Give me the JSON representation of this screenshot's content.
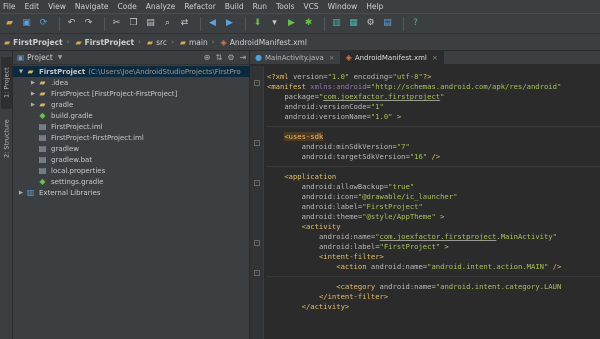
{
  "menu": [
    "File",
    "Edit",
    "View",
    "Navigate",
    "Code",
    "Analyze",
    "Refactor",
    "Build",
    "Run",
    "Tools",
    "VCS",
    "Window",
    "Help"
  ],
  "breadcrumbs": [
    {
      "label": "FirstProject",
      "icon": "folder-icon"
    },
    {
      "label": "FirstProject",
      "icon": "module-folder-icon"
    },
    {
      "label": "src",
      "icon": "folder-icon"
    },
    {
      "label": "main",
      "icon": "folder-icon"
    },
    {
      "label": "AndroidManifest.xml",
      "icon": "xml-file-icon"
    }
  ],
  "side_tabs": {
    "project": "1: Project",
    "structure": "2: Structure"
  },
  "project_panel": {
    "view_selector": "Project",
    "tree": [
      {
        "label": "FirstProject",
        "suffix": "(C:\\Users\\Joe\\AndroidStudioProjects\\FirstPro",
        "indent": 0,
        "icon": "folder",
        "expanded": true,
        "selected": true
      },
      {
        "label": ".idea",
        "indent": 1,
        "icon": "folder",
        "expanded": false
      },
      {
        "label": "FirstProject [FirstProject-FirstProject]",
        "indent": 1,
        "icon": "folder",
        "expanded": false
      },
      {
        "label": "gradle",
        "indent": 1,
        "icon": "folder",
        "expanded": false
      },
      {
        "label": "build.gradle",
        "indent": 1,
        "icon": "grad",
        "leaf": true
      },
      {
        "label": "FirstProject.iml",
        "indent": 1,
        "icon": "file",
        "leaf": true
      },
      {
        "label": "FirstProject-FirstProject.iml",
        "indent": 1,
        "icon": "file",
        "leaf": true
      },
      {
        "label": "gradlew",
        "indent": 1,
        "icon": "file",
        "leaf": true
      },
      {
        "label": "gradlew.bat",
        "indent": 1,
        "icon": "file",
        "leaf": true
      },
      {
        "label": "local.properties",
        "indent": 1,
        "icon": "file",
        "leaf": true
      },
      {
        "label": "settings.gradle",
        "indent": 1,
        "icon": "grad",
        "leaf": true
      },
      {
        "label": "External Libraries",
        "indent": 0,
        "icon": "lib",
        "expanded": false
      }
    ]
  },
  "editor": {
    "tabs": [
      {
        "label": "MainActivity.java",
        "icon": "java-class-icon",
        "active": false
      },
      {
        "label": "AndroidManifest.xml",
        "icon": "xml-file-icon",
        "active": true
      }
    ]
  },
  "code_lines": [
    "<?xml version=\"1.0\" encoding=\"utf-8\"?>",
    "<manifest xmlns:android=\"http://schemas.android.com/apk/res/android\"",
    "    package=\"com.joexfactor.firstproject\"",
    "    android:versionCode=\"1\"",
    "    android:versionName=\"1.0\" >",
    "",
    "    <uses-sdk",
    "        android:minSdkVersion=\"7\"",
    "        android:targetSdkVersion=\"16\" />",
    "",
    "    <application",
    "        android:allowBackup=\"true\"",
    "        android:icon=\"@drawable/ic_launcher\"",
    "        android:label=\"FirstProject\"",
    "        android:theme=\"@style/AppTheme\" >",
    "        <activity",
    "            android:name=\"com.joexfactor.firstproject.MainActivity\"",
    "            android:label=\"FirstProject\" >",
    "            <intent-filter>",
    "                <action android:name=\"android.intent.action.MAIN\" />",
    "",
    "                <category android:name=\"android.intent.category.LAUN",
    "            </intent-filter>",
    "        </activity>"
  ],
  "colors": {
    "background": "#2b2b2b",
    "panel": "#3c3f41",
    "selection": "#0d293e",
    "tag": "#e8bf6a",
    "attribute_value": "#a5c25c"
  }
}
